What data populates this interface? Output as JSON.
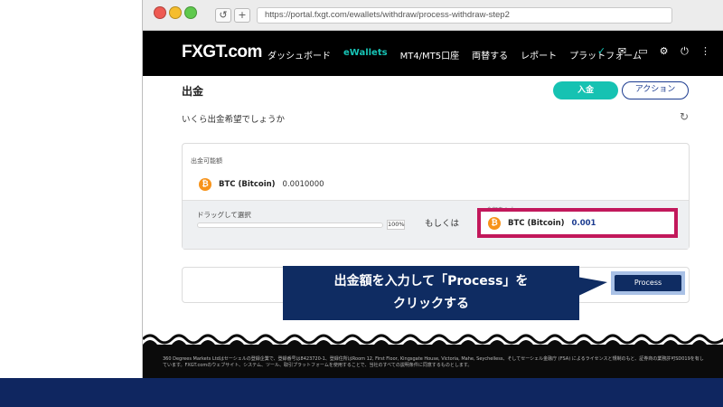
{
  "browser": {
    "url": "https://portal.fxgt.com/ewallets/withdraw/process-withdraw-step2",
    "reload_glyph": "↺",
    "new_tab_glyph": "+"
  },
  "header": {
    "logo": "FXGT.com",
    "menu": [
      {
        "label": "ダッシュボード",
        "active": false
      },
      {
        "label": "eWallets",
        "active": true
      },
      {
        "label": "MT4/MT5口座",
        "active": false
      },
      {
        "label": "両替する",
        "active": false
      },
      {
        "label": "レポート",
        "active": false
      },
      {
        "label": "プラットフォーム",
        "active": false
      }
    ],
    "icons": [
      "verified-icon",
      "mail-icon",
      "card-icon",
      "gear-icon",
      "power-icon",
      "menu-icon"
    ]
  },
  "page": {
    "title": "出金",
    "deposit_label": "入金",
    "action_label": "アクション",
    "question": "いくら出金希望でしょうか"
  },
  "available": {
    "label": "出金可能額",
    "currency": "BTC (Bitcoin)",
    "amount": "0.0010000"
  },
  "slider": {
    "label": "ドラッグして選択",
    "percent_text": "100%",
    "level": 1.0,
    "or_text": "もしくは"
  },
  "amount_input": {
    "label": "金額を入力",
    "currency": "BTC (Bitcoin)",
    "value": "0.001"
  },
  "process": {
    "label": "Process"
  },
  "callout": {
    "line1": "出金額を入力して「Process」を",
    "line2": "クリックする"
  },
  "footer": {
    "text": "360 Degrees Markets Ltdはセーシェルの登録企業で、登録番号は8423720-1、登録住所はRoom 12, First Floor, Kingsgate House, Victoria, Mahe, Seychelless、そしてセーシェル金融庁 (FSA) によるライセンスと規制のもと、証券商の業務許可SD019を有しています。FXGT.comのウェブサイト、システム、ツール、取引プラットフォームを使用することで、当社のすべての説明条件に同意するものとします。"
  },
  "colors": {
    "accent_teal": "#16c2b2",
    "navy": "#0f2c62",
    "highlight_magenta": "#c2185b",
    "bitcoin_orange": "#f7931a"
  }
}
